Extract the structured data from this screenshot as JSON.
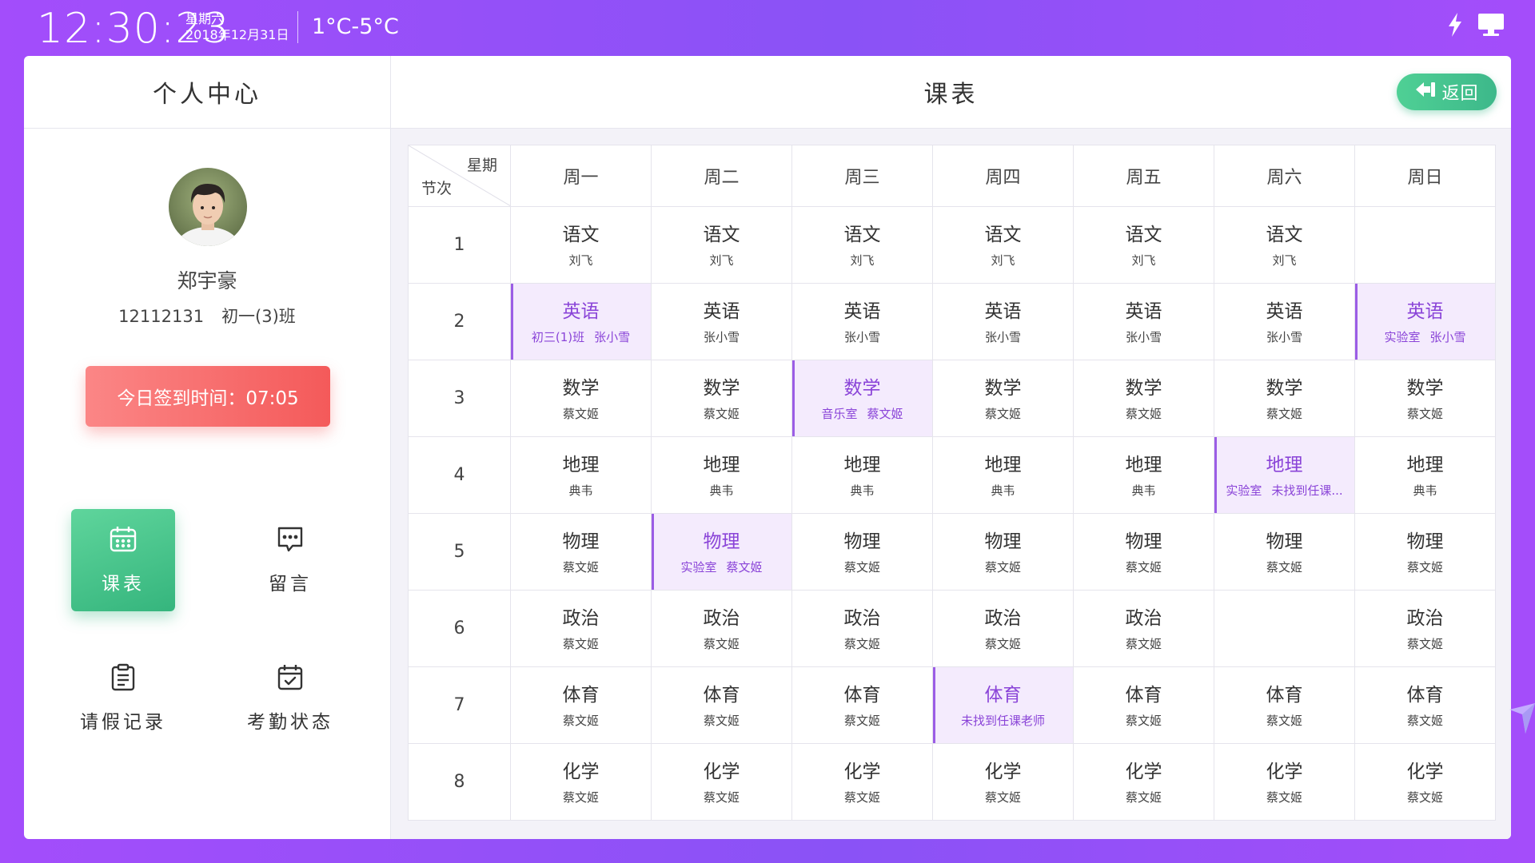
{
  "status_bar": {
    "time": "12:30:23",
    "weekday": "星期六",
    "date": "2018年12月31日",
    "temperature": "1°C-5°C",
    "icons": [
      "lightning-icon",
      "monitor-icon"
    ]
  },
  "left_panel": {
    "title": "个人中心",
    "student": {
      "name": "郑宇豪",
      "id": "12112131",
      "class": "初一(3)班"
    },
    "signin": {
      "label": "今日签到时间：07:05"
    },
    "menu": [
      {
        "label": "课表",
        "icon": "calendar-icon",
        "active": true
      },
      {
        "label": "留言",
        "icon": "message-icon",
        "active": false
      },
      {
        "label": "请假记录",
        "icon": "clipboard-icon",
        "active": false
      },
      {
        "label": "考勤状态",
        "icon": "calendar-check-icon",
        "active": false
      }
    ]
  },
  "right_panel": {
    "title": "课表",
    "back_label": "返回"
  },
  "timetable": {
    "corner_week": "星期",
    "corner_period": "节次",
    "days": [
      "周一",
      "周二",
      "周三",
      "周四",
      "周五",
      "周六",
      "周日"
    ],
    "periods": [
      {
        "num": "1",
        "cells": [
          {
            "subject": "语文",
            "teacher": "刘飞"
          },
          {
            "subject": "语文",
            "teacher": "刘飞"
          },
          {
            "subject": "语文",
            "teacher": "刘飞"
          },
          {
            "subject": "语文",
            "teacher": "刘飞"
          },
          {
            "subject": "语文",
            "teacher": "刘飞"
          },
          {
            "subject": "语文",
            "teacher": "刘飞"
          },
          {
            "subject": "",
            "teacher": ""
          }
        ]
      },
      {
        "num": "2",
        "cells": [
          {
            "subject": "英语",
            "room": "初三(1)班",
            "teacher": "张小雪",
            "highlight": true
          },
          {
            "subject": "英语",
            "teacher": "张小雪"
          },
          {
            "subject": "英语",
            "teacher": "张小雪"
          },
          {
            "subject": "英语",
            "teacher": "张小雪"
          },
          {
            "subject": "英语",
            "teacher": "张小雪"
          },
          {
            "subject": "英语",
            "teacher": "张小雪"
          },
          {
            "subject": "英语",
            "room": "实验室",
            "teacher": "张小雪",
            "highlight": true
          }
        ]
      },
      {
        "num": "3",
        "cells": [
          {
            "subject": "数学",
            "teacher": "蔡文姬"
          },
          {
            "subject": "数学",
            "teacher": "蔡文姬"
          },
          {
            "subject": "数学",
            "room": "音乐室",
            "teacher": "蔡文姬",
            "highlight": true
          },
          {
            "subject": "数学",
            "teacher": "蔡文姬"
          },
          {
            "subject": "数学",
            "teacher": "蔡文姬"
          },
          {
            "subject": "数学",
            "teacher": "蔡文姬"
          },
          {
            "subject": "数学",
            "teacher": "蔡文姬"
          }
        ]
      },
      {
        "num": "4",
        "cells": [
          {
            "subject": "地理",
            "teacher": "典韦"
          },
          {
            "subject": "地理",
            "teacher": "典韦"
          },
          {
            "subject": "地理",
            "teacher": "典韦"
          },
          {
            "subject": "地理",
            "teacher": "典韦"
          },
          {
            "subject": "地理",
            "teacher": "典韦"
          },
          {
            "subject": "地理",
            "room": "实验室",
            "teacher": "未找到任课...",
            "highlight": true
          },
          {
            "subject": "地理",
            "teacher": "典韦"
          }
        ]
      },
      {
        "num": "5",
        "cells": [
          {
            "subject": "物理",
            "teacher": "蔡文姬"
          },
          {
            "subject": "物理",
            "room": "实验室",
            "teacher": "蔡文姬",
            "highlight": true
          },
          {
            "subject": "物理",
            "teacher": "蔡文姬"
          },
          {
            "subject": "物理",
            "teacher": "蔡文姬"
          },
          {
            "subject": "物理",
            "teacher": "蔡文姬"
          },
          {
            "subject": "物理",
            "teacher": "蔡文姬"
          },
          {
            "subject": "物理",
            "teacher": "蔡文姬"
          }
        ]
      },
      {
        "num": "6",
        "cells": [
          {
            "subject": "政治",
            "teacher": "蔡文姬"
          },
          {
            "subject": "政治",
            "teacher": "蔡文姬"
          },
          {
            "subject": "政治",
            "teacher": "蔡文姬"
          },
          {
            "subject": "政治",
            "teacher": "蔡文姬"
          },
          {
            "subject": "政治",
            "teacher": "蔡文姬"
          },
          {
            "subject": "",
            "teacher": ""
          },
          {
            "subject": "政治",
            "teacher": "蔡文姬"
          }
        ]
      },
      {
        "num": "7",
        "cells": [
          {
            "subject": "体育",
            "teacher": "蔡文姬"
          },
          {
            "subject": "体育",
            "teacher": "蔡文姬"
          },
          {
            "subject": "体育",
            "teacher": "蔡文姬"
          },
          {
            "subject": "体育",
            "teacher": "未找到任课老师",
            "highlight": true
          },
          {
            "subject": "体育",
            "teacher": "蔡文姬"
          },
          {
            "subject": "体育",
            "teacher": "蔡文姬"
          },
          {
            "subject": "体育",
            "teacher": "蔡文姬"
          }
        ]
      },
      {
        "num": "8",
        "cells": [
          {
            "subject": "化学",
            "teacher": "蔡文姬"
          },
          {
            "subject": "化学",
            "teacher": "蔡文姬"
          },
          {
            "subject": "化学",
            "teacher": "蔡文姬"
          },
          {
            "subject": "化学",
            "teacher": "蔡文姬"
          },
          {
            "subject": "化学",
            "teacher": "蔡文姬"
          },
          {
            "subject": "化学",
            "teacher": "蔡文姬"
          },
          {
            "subject": "化学",
            "teacher": "蔡文姬"
          }
        ]
      }
    ]
  },
  "colors": {
    "background": "#9a4ffa",
    "accent_green": "#3db88a",
    "signin_red": "#f45a5a",
    "highlight_purple": "#8a44d8",
    "highlight_bg": "#f4ebfd"
  }
}
